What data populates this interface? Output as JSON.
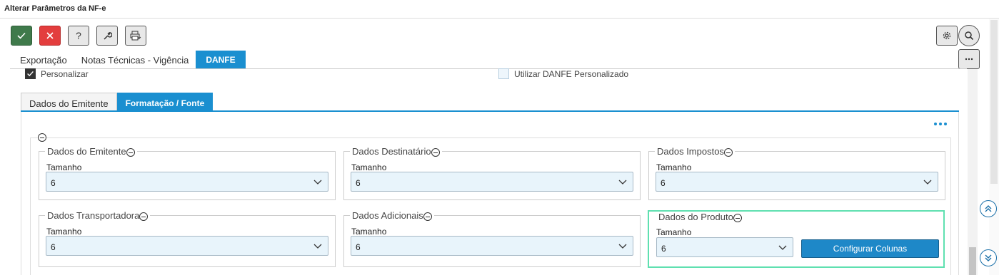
{
  "window": {
    "title": "Alterar Parâmetros da NF-e"
  },
  "toolbar": {
    "confirm_icon": "check-icon",
    "cancel_icon": "close-icon",
    "help_label": "?",
    "tools_icon": "wrench-icon",
    "print_icon": "printer-icon",
    "settings_icon": "gear-icon",
    "search_icon": "search-icon",
    "more_icon": "ellipsis-icon"
  },
  "main_tabs": [
    {
      "label": "Exportação",
      "active": false
    },
    {
      "label": "Notas Técnicas - Vigência",
      "active": false
    },
    {
      "label": "DANFE",
      "active": true
    }
  ],
  "options": {
    "personalizar": {
      "label": "Personalizar",
      "checked": true
    },
    "utilizar_danfe": {
      "label": "Utilizar DANFE Personalizado",
      "checked": false
    }
  },
  "sub_tabs": [
    {
      "label": "Dados do Emitente",
      "active": false
    },
    {
      "label": "Formatação / Fonte",
      "active": true
    }
  ],
  "sections": {
    "emitente": {
      "legend": "Dados do Emitente",
      "field_label": "Tamanho",
      "value": "6"
    },
    "destinatario": {
      "legend": "Dados Destinatário",
      "field_label": "Tamanho",
      "value": "6"
    },
    "impostos": {
      "legend": "Dados Impostos",
      "field_label": "Tamanho",
      "value": "6"
    },
    "transportadora": {
      "legend": "Dados Transportadora",
      "field_label": "Tamanho",
      "value": "6"
    },
    "adicionais": {
      "legend": "Dados Adicionais",
      "field_label": "Tamanho",
      "value": "6"
    },
    "produto": {
      "legend": "Dados do Produto",
      "field_label": "Tamanho",
      "value": "6",
      "button_label": "Configurar Colunas"
    }
  },
  "colors": {
    "accent": "#1a8fd0",
    "confirm": "#3f7a4b",
    "cancel": "#e33d3d",
    "highlight_border": "#5fe0b0"
  }
}
